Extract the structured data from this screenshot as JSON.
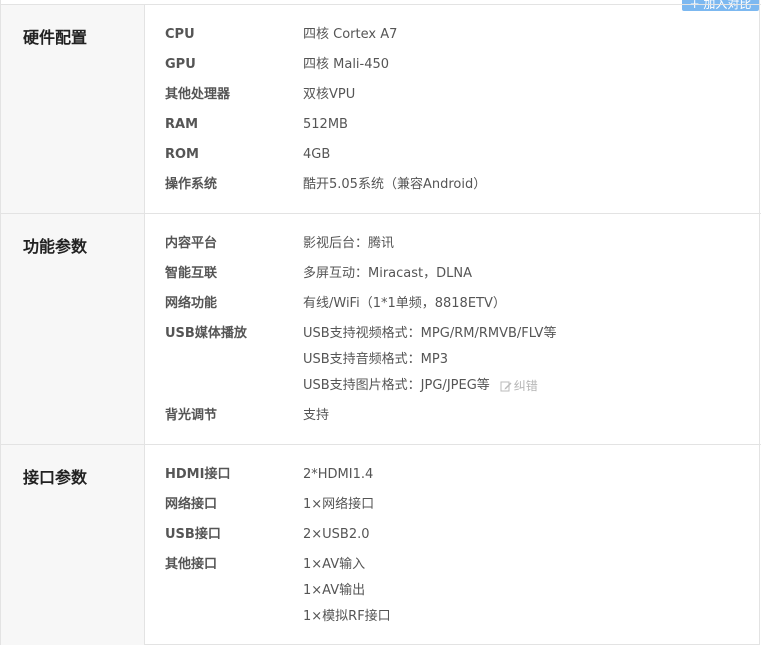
{
  "compare_button": "+ 加入对比",
  "sections": [
    {
      "title": "硬件配置",
      "rows": [
        {
          "label": "CPU",
          "values": [
            "四核 Cortex A7"
          ]
        },
        {
          "label": "GPU",
          "values": [
            "四核 Mali-450"
          ]
        },
        {
          "label": "其他处理器",
          "values": [
            "双核VPU"
          ]
        },
        {
          "label": "RAM",
          "values": [
            "512MB"
          ]
        },
        {
          "label": "ROM",
          "values": [
            "4GB"
          ]
        },
        {
          "label": "操作系统",
          "values": [
            "酷开5.05系统（兼容Android）"
          ]
        }
      ]
    },
    {
      "title": "功能参数",
      "rows": [
        {
          "label": "内容平台",
          "values": [
            "影视后台：腾讯"
          ]
        },
        {
          "label": "智能互联",
          "values": [
            "多屏互动：Miracast，DLNA"
          ]
        },
        {
          "label": "网络功能",
          "values": [
            "有线/WiFi（1*1单频，8818ETV）"
          ]
        },
        {
          "label": "USB媒体播放",
          "values": [
            "USB支持视频格式：MPG/RM/RMVB/FLV等",
            "USB支持音频格式：MP3",
            "USB支持图片格式：JPG/JPEG等"
          ],
          "report": "纠错"
        },
        {
          "label": "背光调节",
          "values": [
            "支持"
          ]
        }
      ]
    },
    {
      "title": "接口参数",
      "rows": [
        {
          "label": "HDMI接口",
          "values": [
            "2*HDMI1.4"
          ]
        },
        {
          "label": "网络接口",
          "values": [
            "1×网络接口"
          ]
        },
        {
          "label": "USB接口",
          "values": [
            "2×USB2.0"
          ]
        },
        {
          "label": "其他接口",
          "values": [
            "1×AV输入",
            "1×AV输出",
            "1×模拟RF接口"
          ]
        }
      ]
    }
  ]
}
